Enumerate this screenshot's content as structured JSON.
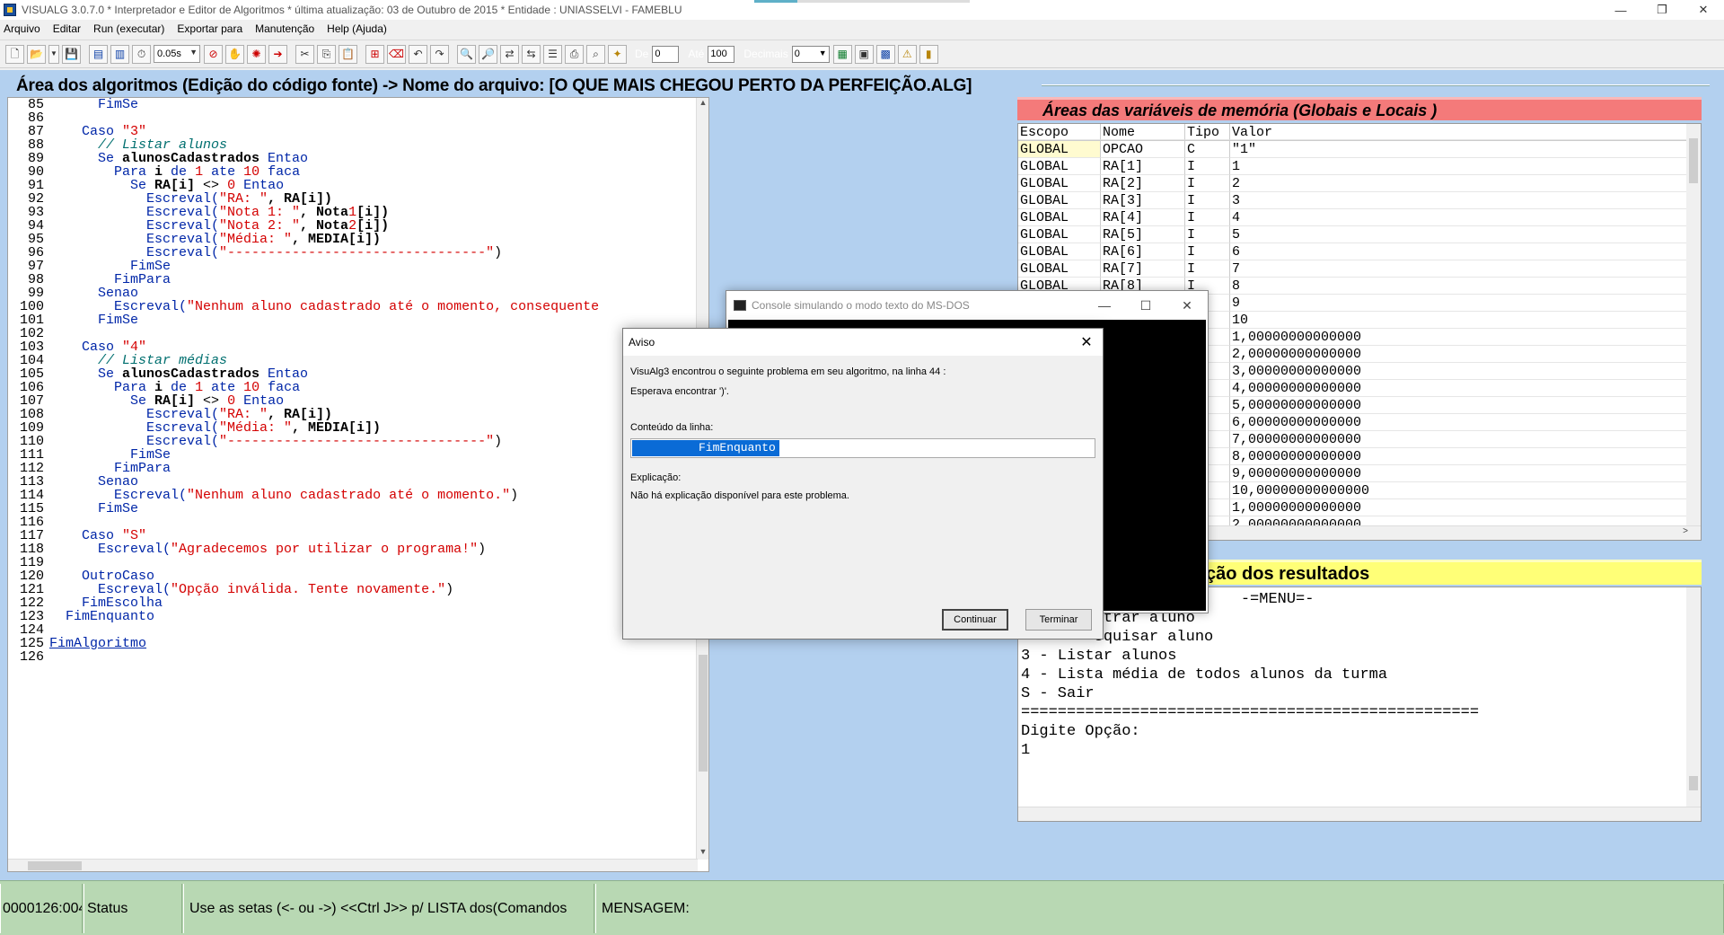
{
  "window": {
    "title": "VISUALG 3.0.7.0 * Interpretador e Editor de Algoritmos * última atualização: 03 de Outubro de 2015 * Entidade : UNIASSELVI - FAMEBLU",
    "controls": [
      "—",
      "❐",
      "✕"
    ]
  },
  "menu": [
    "Arquivo",
    "Editar",
    "Run (executar)",
    "Exportar para",
    "Manutenção",
    "Help (Ajuda)"
  ],
  "toolbar": {
    "speed": "0.05s",
    "de_label": "De",
    "de_value": "0",
    "ate_label": "Até",
    "ate_value": "100",
    "decimais_label": "Decimais",
    "decimais_value": "0"
  },
  "editor": {
    "header": "Área dos algoritmos (Edição do código fonte) -> Nome do arquivo: [O QUE MAIS CHEGOU PERTO DA PERFEIÇÃO.ALG]",
    "lines": [
      {
        "n": "85",
        "parts": [
          [
            "      ",
            ""
          ],
          [
            "FimSe",
            "kw"
          ]
        ]
      },
      {
        "n": "86",
        "parts": []
      },
      {
        "n": "87",
        "parts": [
          [
            "    Caso ",
            "kw"
          ],
          [
            "\"3\"",
            "str"
          ]
        ]
      },
      {
        "n": "88",
        "parts": [
          [
            "      ",
            ""
          ],
          [
            "// Listar alunos",
            "cmt"
          ]
        ]
      },
      {
        "n": "89",
        "parts": [
          [
            "      Se ",
            "kw"
          ],
          [
            "alunosCadastrados",
            "bold"
          ],
          [
            " Entao",
            "kw"
          ]
        ]
      },
      {
        "n": "90",
        "parts": [
          [
            "        Para ",
            "kw"
          ],
          [
            "i",
            "bold"
          ],
          [
            " de ",
            "kw"
          ],
          [
            "1",
            "num"
          ],
          [
            " ate ",
            "kw"
          ],
          [
            "10",
            "num"
          ],
          [
            " faca",
            "kw"
          ]
        ]
      },
      {
        "n": "91",
        "parts": [
          [
            "          Se ",
            "kw"
          ],
          [
            "RA[i]",
            "bold"
          ],
          [
            " <> ",
            ""
          ],
          [
            "0",
            "num"
          ],
          [
            " Entao",
            "kw"
          ]
        ]
      },
      {
        "n": "92",
        "parts": [
          [
            "            Escreval(",
            "kw"
          ],
          [
            "\"RA: \"",
            "str"
          ],
          [
            ", RA[i])",
            "bold"
          ]
        ]
      },
      {
        "n": "93",
        "parts": [
          [
            "            Escreval(",
            "kw"
          ],
          [
            "\"Nota 1: \"",
            "str"
          ],
          [
            ", Nota",
            "bold"
          ],
          [
            "1",
            "num"
          ],
          [
            "[i])",
            "bold"
          ]
        ]
      },
      {
        "n": "94",
        "parts": [
          [
            "            Escreval(",
            "kw"
          ],
          [
            "\"Nota 2: \"",
            "str"
          ],
          [
            ", Nota",
            "bold"
          ],
          [
            "2",
            "num"
          ],
          [
            "[i])",
            "bold"
          ]
        ]
      },
      {
        "n": "95",
        "parts": [
          [
            "            Escreval(",
            "kw"
          ],
          [
            "\"Média: \"",
            "str"
          ],
          [
            ", MEDIA[i])",
            "bold"
          ]
        ]
      },
      {
        "n": "96",
        "parts": [
          [
            "            Escreval(",
            "kw"
          ],
          [
            "\"--------------------------------\"",
            "str"
          ],
          [
            ")",
            ""
          ]
        ]
      },
      {
        "n": "97",
        "parts": [
          [
            "          FimSe",
            "kw"
          ]
        ]
      },
      {
        "n": "98",
        "parts": [
          [
            "        FimPara",
            "kw"
          ]
        ]
      },
      {
        "n": "99",
        "parts": [
          [
            "      Senao",
            "kw"
          ]
        ]
      },
      {
        "n": "100",
        "parts": [
          [
            "        Escreval(",
            "kw"
          ],
          [
            "\"Nenhum aluno cadastrado até o momento, consequente",
            "str"
          ]
        ]
      },
      {
        "n": "101",
        "parts": [
          [
            "      FimSe",
            "kw"
          ]
        ]
      },
      {
        "n": "102",
        "parts": []
      },
      {
        "n": "103",
        "parts": [
          [
            "    Caso ",
            "kw"
          ],
          [
            "\"4\"",
            "str"
          ]
        ]
      },
      {
        "n": "104",
        "parts": [
          [
            "      ",
            ""
          ],
          [
            "// Listar médias",
            "cmt"
          ]
        ]
      },
      {
        "n": "105",
        "parts": [
          [
            "      Se ",
            "kw"
          ],
          [
            "alunosCadastrados",
            "bold"
          ],
          [
            " Entao",
            "kw"
          ]
        ]
      },
      {
        "n": "106",
        "parts": [
          [
            "        Para ",
            "kw"
          ],
          [
            "i",
            "bold"
          ],
          [
            " de ",
            "kw"
          ],
          [
            "1",
            "num"
          ],
          [
            " ate ",
            "kw"
          ],
          [
            "10",
            "num"
          ],
          [
            " faca",
            "kw"
          ]
        ]
      },
      {
        "n": "107",
        "parts": [
          [
            "          Se ",
            "kw"
          ],
          [
            "RA[i]",
            "bold"
          ],
          [
            " <> ",
            ""
          ],
          [
            "0",
            "num"
          ],
          [
            " Entao",
            "kw"
          ]
        ]
      },
      {
        "n": "108",
        "parts": [
          [
            "            Escreval(",
            "kw"
          ],
          [
            "\"RA: \"",
            "str"
          ],
          [
            ", RA[i])",
            "bold"
          ]
        ]
      },
      {
        "n": "109",
        "parts": [
          [
            "            Escreval(",
            "kw"
          ],
          [
            "\"Média: \"",
            "str"
          ],
          [
            ", MEDIA[i])",
            "bold"
          ]
        ]
      },
      {
        "n": "110",
        "parts": [
          [
            "            Escreval(",
            "kw"
          ],
          [
            "\"--------------------------------\"",
            "str"
          ],
          [
            ")",
            ""
          ]
        ]
      },
      {
        "n": "111",
        "parts": [
          [
            "          FimSe",
            "kw"
          ]
        ]
      },
      {
        "n": "112",
        "parts": [
          [
            "        FimPara",
            "kw"
          ]
        ]
      },
      {
        "n": "113",
        "parts": [
          [
            "      Senao",
            "kw"
          ]
        ]
      },
      {
        "n": "114",
        "parts": [
          [
            "        Escreval(",
            "kw"
          ],
          [
            "\"Nenhum aluno cadastrado até o momento.\"",
            "str"
          ],
          [
            ")",
            ""
          ]
        ]
      },
      {
        "n": "115",
        "parts": [
          [
            "      FimSe",
            "kw"
          ]
        ]
      },
      {
        "n": "116",
        "parts": []
      },
      {
        "n": "117",
        "parts": [
          [
            "    Caso ",
            "kw"
          ],
          [
            "\"S\"",
            "str"
          ]
        ]
      },
      {
        "n": "118",
        "parts": [
          [
            "      Escreval(",
            "kw"
          ],
          [
            "\"Agradecemos por utilizar o programa!\"",
            "str"
          ],
          [
            ")",
            ""
          ]
        ]
      },
      {
        "n": "119",
        "parts": []
      },
      {
        "n": "120",
        "parts": [
          [
            "    OutroCaso",
            "kw"
          ]
        ]
      },
      {
        "n": "121",
        "parts": [
          [
            "      Escreval(",
            "kw"
          ],
          [
            "\"Opção inválida. Tente novamente.\"",
            "str"
          ],
          [
            ")",
            ""
          ]
        ]
      },
      {
        "n": "122",
        "parts": [
          [
            "    FimEscolha",
            "kw"
          ]
        ]
      },
      {
        "n": "123",
        "parts": [
          [
            "  FimEnquanto",
            "kw"
          ]
        ]
      },
      {
        "n": "124",
        "parts": []
      },
      {
        "n": "125",
        "parts": [
          [
            "FimAlgoritmo",
            "link"
          ]
        ]
      },
      {
        "n": "126",
        "parts": []
      }
    ]
  },
  "variables": {
    "header": "Áreas das variáveis de memória (Globais e Locais )",
    "columns": [
      "Escopo",
      "Nome",
      "Tipo",
      "Valor"
    ],
    "rows": [
      [
        "GLOBAL",
        "OPCAO",
        "C",
        "\"1\""
      ],
      [
        "GLOBAL",
        "RA[1]",
        "I",
        "1"
      ],
      [
        "GLOBAL",
        "RA[2]",
        "I",
        "2"
      ],
      [
        "GLOBAL",
        "RA[3]",
        "I",
        "3"
      ],
      [
        "GLOBAL",
        "RA[4]",
        "I",
        "4"
      ],
      [
        "GLOBAL",
        "RA[5]",
        "I",
        "5"
      ],
      [
        "GLOBAL",
        "RA[6]",
        "I",
        "6"
      ],
      [
        "GLOBAL",
        "RA[7]",
        "I",
        "7"
      ],
      [
        "GLOBAL",
        "RA[8]",
        "I",
        "8"
      ],
      [
        "",
        "",
        "",
        "9"
      ],
      [
        "",
        "",
        "",
        "10"
      ],
      [
        "",
        "",
        "",
        "1,00000000000000"
      ],
      [
        "",
        "",
        "",
        "2,00000000000000"
      ],
      [
        "",
        "",
        "",
        "3,00000000000000"
      ],
      [
        "",
        "",
        "",
        "4,00000000000000"
      ],
      [
        "",
        "",
        "",
        "5,00000000000000"
      ],
      [
        "",
        "",
        "",
        "6,00000000000000"
      ],
      [
        "",
        "",
        "",
        "7,00000000000000"
      ],
      [
        "",
        "",
        "",
        "8,00000000000000"
      ],
      [
        "",
        "",
        "",
        "9,00000000000000"
      ],
      [
        "",
        "",
        "",
        "10,00000000000000"
      ],
      [
        "",
        "",
        "",
        "1,00000000000000"
      ],
      [
        "",
        "",
        "",
        "2,00000000000000"
      ]
    ]
  },
  "results": {
    "header": "ção dos resultados",
    "lines": [
      "                        -=MENU=-",
      "        strar aluno",
      "        squisar aluno",
      "3 - Listar alunos",
      "4 - Lista média de todos alunos da turma",
      "S - Sair",
      "==================================================",
      "Digite Opção:",
      "1"
    ]
  },
  "console": {
    "title": "Console simulando o modo texto do MS-DOS"
  },
  "dialog": {
    "title": "Aviso",
    "message": "VisuAlg3 encontrou o seguinte problema em seu algoritmo, na linha 44 :",
    "expected": "Esperava encontrar ')'.",
    "line_label": "Conteúdo da linha:",
    "line_content": "FimEnquanto",
    "explanation_label": "Explicação:",
    "explanation": "Não há explicação disponível para este problema.",
    "continue_label": "Continuar",
    "terminate_label": "Terminar"
  },
  "status": {
    "position": "0000126:004",
    "status_label": "Status",
    "hint": "Use as setas (<- ou ->) <<Ctrl J>> p/ LISTA dos(Comandos",
    "message_label": "MENSAGEM:"
  }
}
